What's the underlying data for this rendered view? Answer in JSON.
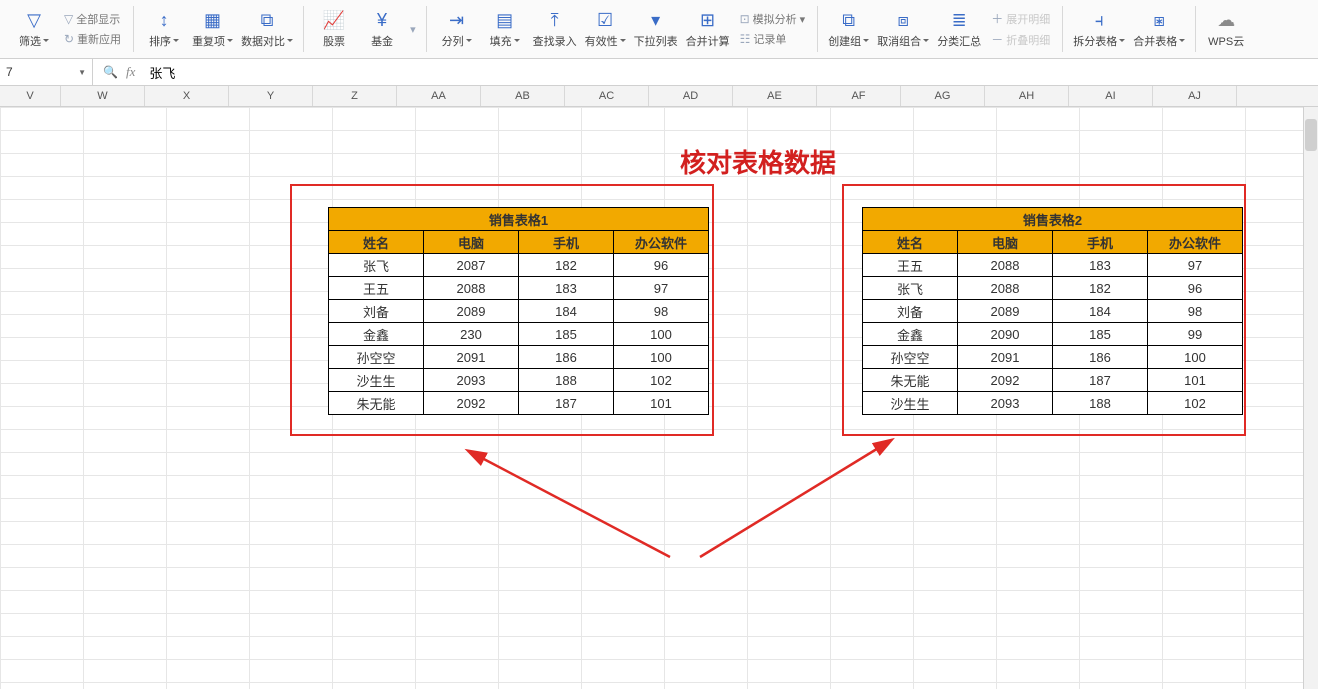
{
  "toolbar": {
    "mini": {
      "show_all": "全部显示",
      "reapply": "重新应用",
      "analyze": "模拟分析",
      "record_form": "记录单",
      "expand": "展开明细",
      "collapse": "折叠明细"
    },
    "filter": "筛选",
    "sort": "排序",
    "dedup": "重复项",
    "data_compare": "数据对比",
    "stocks": "股票",
    "funds": "基金",
    "text_to_cols": "分列",
    "fill": "填充",
    "find_input": "查找录入",
    "validation": "有效性",
    "dropdown_list": "下拉列表",
    "consolidate": "合并计算",
    "group": "创建组",
    "ungroup": "取消组合",
    "subtotal": "分类汇总",
    "split_table": "拆分表格",
    "merge_table": "合并表格",
    "wps_cloud": "WPS云"
  },
  "formula_bar": {
    "namebox": "7",
    "value": "张飞"
  },
  "columns": [
    "V",
    "W",
    "X",
    "Y",
    "Z",
    "AA",
    "AB",
    "AC",
    "AD",
    "AE",
    "AF",
    "AG",
    "AH",
    "AI",
    "AJ"
  ],
  "annotation_title": "核对表格数据",
  "table1": {
    "title": "销售表格1",
    "headers": [
      "姓名",
      "电脑",
      "手机",
      "办公软件"
    ],
    "rows": [
      [
        "张飞",
        "2087",
        "182",
        "96"
      ],
      [
        "王五",
        "2088",
        "183",
        "97"
      ],
      [
        "刘备",
        "2089",
        "184",
        "98"
      ],
      [
        "金鑫",
        "230",
        "185",
        "100"
      ],
      [
        "孙空空",
        "2091",
        "186",
        "100"
      ],
      [
        "沙生生",
        "2093",
        "188",
        "102"
      ],
      [
        "朱无能",
        "2092",
        "187",
        "101"
      ]
    ]
  },
  "table2": {
    "title": "销售表格2",
    "headers": [
      "姓名",
      "电脑",
      "手机",
      "办公软件"
    ],
    "rows": [
      [
        "王五",
        "2088",
        "183",
        "97"
      ],
      [
        "张飞",
        "2088",
        "182",
        "96"
      ],
      [
        "刘备",
        "2089",
        "184",
        "98"
      ],
      [
        "金鑫",
        "2090",
        "185",
        "99"
      ],
      [
        "孙空空",
        "2091",
        "186",
        "100"
      ],
      [
        "朱无能",
        "2092",
        "187",
        "101"
      ],
      [
        "沙生生",
        "2093",
        "188",
        "102"
      ]
    ]
  }
}
